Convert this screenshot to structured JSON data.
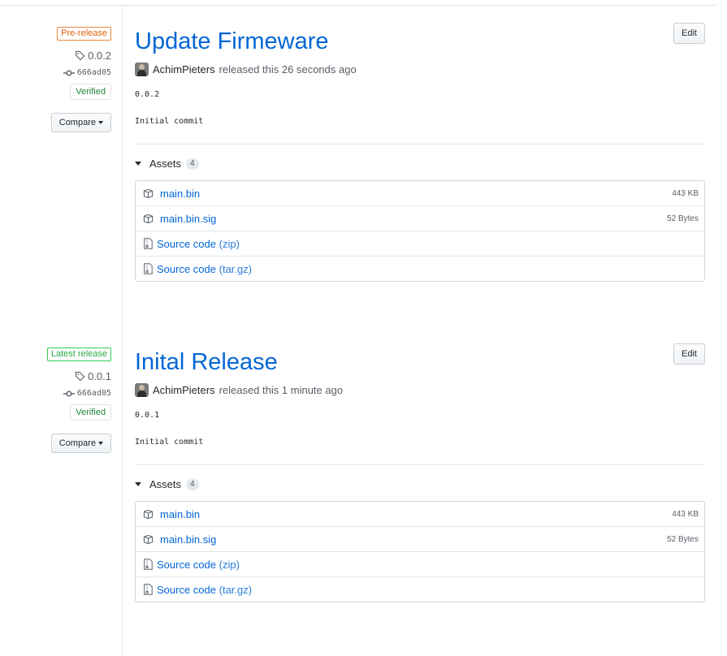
{
  "colors": {
    "link": "#0366d6",
    "pre_release": "#e36209",
    "latest": "#28a745",
    "verified": "#22863a",
    "border": "#e1e4e8"
  },
  "releases": [
    {
      "badge": "Pre-release",
      "badge_type": "pre",
      "tag": "0.0.2",
      "commit": "666ad05",
      "verified": "Verified",
      "compare": "Compare",
      "title": "Update Firmeware",
      "edit": "Edit",
      "author": "AchimPieters",
      "released_text": "released this 26 seconds ago",
      "notes": [
        "0.0.2",
        "Initial commit"
      ],
      "assets_label": "Assets",
      "assets_count": "4",
      "assets": [
        {
          "icon": "package-icon",
          "name": "main.bin",
          "size": "443 KB"
        },
        {
          "icon": "package-icon",
          "name": "main.bin.sig",
          "size": "52 Bytes"
        },
        {
          "icon": "file-zip-icon",
          "name": "Source code",
          "suffix": "(zip)"
        },
        {
          "icon": "file-zip-icon",
          "name": "Source code",
          "suffix": "(tar.gz)"
        }
      ]
    },
    {
      "badge": "Latest release",
      "badge_type": "latest",
      "tag": "0.0.1",
      "commit": "666ad05",
      "verified": "Verified",
      "compare": "Compare",
      "title": "Inital Release",
      "edit": "Edit",
      "author": "AchimPieters",
      "released_text": "released this 1 minute ago",
      "notes": [
        "0.0.1",
        "Initial commit"
      ],
      "assets_label": "Assets",
      "assets_count": "4",
      "assets": [
        {
          "icon": "package-icon",
          "name": "main.bin",
          "size": "443 KB"
        },
        {
          "icon": "package-icon",
          "name": "main.bin.sig",
          "size": "52 Bytes"
        },
        {
          "icon": "file-zip-icon",
          "name": "Source code",
          "suffix": "(zip)"
        },
        {
          "icon": "file-zip-icon",
          "name": "Source code",
          "suffix": "(tar.gz)"
        }
      ]
    }
  ]
}
